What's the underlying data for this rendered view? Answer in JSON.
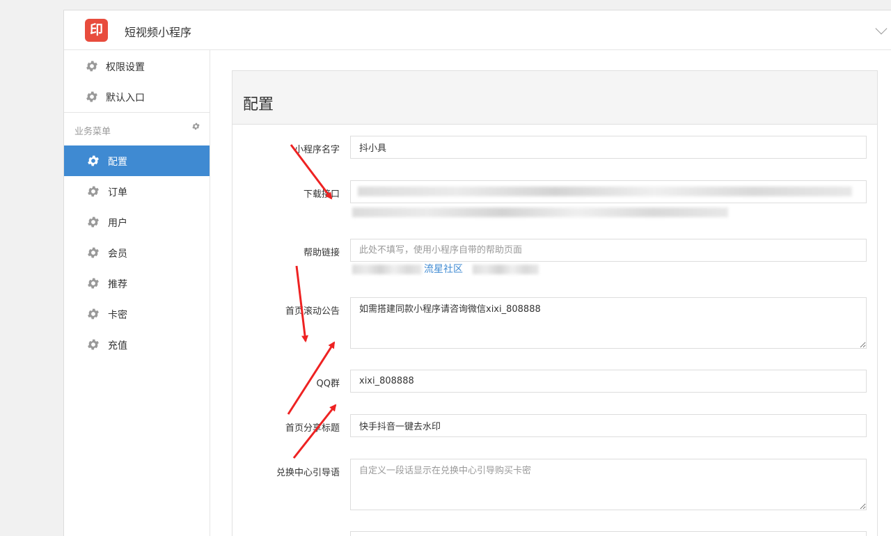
{
  "app": {
    "logo_text": "印",
    "title": "短视频小程序"
  },
  "sidebar": {
    "top_items": [
      {
        "label": "权限设置"
      },
      {
        "label": "默认入口"
      }
    ],
    "section_label": "业务菜单",
    "items": [
      {
        "label": "配置",
        "active": true
      },
      {
        "label": "订单"
      },
      {
        "label": "用户"
      },
      {
        "label": "会员"
      },
      {
        "label": "推荐"
      },
      {
        "label": "卡密"
      },
      {
        "label": "充值"
      }
    ]
  },
  "panel": {
    "title": "配置",
    "fields": {
      "name": {
        "label": "小程序名字",
        "value": "抖小具"
      },
      "download": {
        "label": "下载接口"
      },
      "help": {
        "label": "帮助链接",
        "placeholder": "此处不填写，使用小程序自带的帮助页面",
        "note_link": "流星社区"
      },
      "notice": {
        "label": "首页滚动公告",
        "value": "如需搭建同款小程序请咨询微信xixi_808888"
      },
      "qq": {
        "label": "QQ群",
        "value": "xixi_808888"
      },
      "share_title": {
        "label": "首页分享标题",
        "value": "快手抖音一键去水印"
      },
      "redeem_guide": {
        "label": "兑换中心引导语",
        "placeholder": "自定义一段话显示在兑换中心引导购买卡密"
      }
    }
  },
  "colors": {
    "accent": "#3f8ad2",
    "logo": "#e84c3d",
    "annotation": "#ee2222"
  }
}
